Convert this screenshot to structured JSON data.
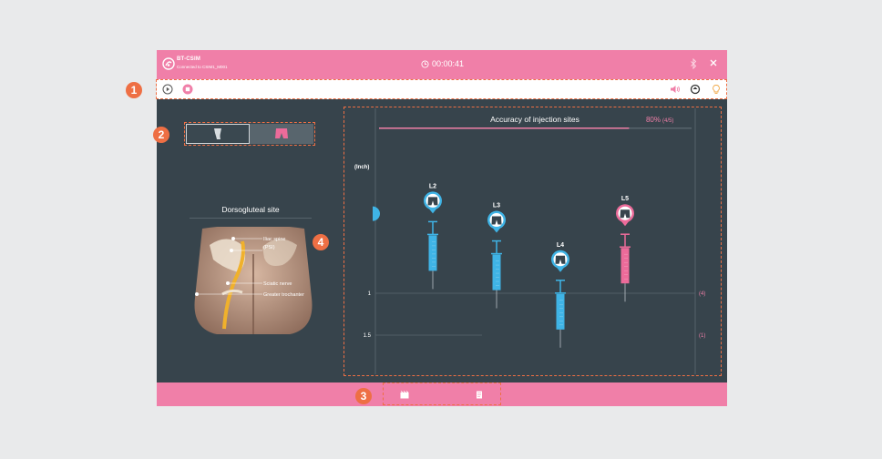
{
  "titlebar": {
    "app_name": "BT-CSIM",
    "connection": "Connected to CSIM1_M001",
    "timer": "00:00:41"
  },
  "toolbar": {
    "left_icons": [
      "play-icon",
      "stop-icon"
    ],
    "right_icons": [
      "volume-icon",
      "refresh-icon",
      "lightbulb-icon"
    ]
  },
  "callouts": [
    "1",
    "2",
    "3",
    "4"
  ],
  "body_toggle": {
    "options": [
      "leg-view-icon",
      "hip-view-icon"
    ],
    "selected": 1
  },
  "site": {
    "title": "Dorsogluteal site",
    "labels": [
      "Iliac spine",
      "(PSI)",
      "Sciatic nerve",
      "Greater trochanter"
    ]
  },
  "chart_data": {
    "type": "scatter",
    "title": "Accuracy of injection sites",
    "accuracy": "80%",
    "accuracy_detail": "(4/5)",
    "accuracy_fraction": 0.8,
    "ylabel": "(Inch)",
    "yticks": [
      "1",
      "1.5"
    ],
    "row_counts": [
      "(4)",
      "(1)"
    ],
    "points": [
      {
        "label": "",
        "depth": 0.05,
        "color": "#3fb4e6",
        "view": "hip"
      },
      {
        "label": "L2",
        "depth": 0.95,
        "color": "#3fb4e6",
        "view": "hip"
      },
      {
        "label": "L3",
        "depth": 1.18,
        "color": "#3fb4e6",
        "view": "hip"
      },
      {
        "label": "L4",
        "depth": 1.65,
        "color": "#3fb4e6",
        "view": "hip"
      },
      {
        "label": "L5",
        "depth": 1.1,
        "color": "#ec6b9a",
        "view": "hip"
      }
    ]
  },
  "bottom_bar": {
    "icons": [
      "film-icon",
      "document-icon"
    ]
  },
  "colors": {
    "pink": "#f07fa8",
    "blue": "#3fb4e6",
    "magenta": "#ec6b9a",
    "panel": "#37444c",
    "accent": "#ee6f44"
  }
}
